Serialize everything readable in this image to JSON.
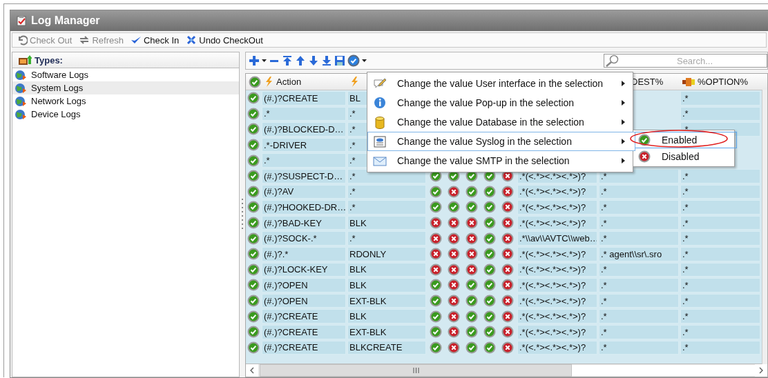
{
  "window": {
    "title": "Log Manager"
  },
  "toolbar": [
    {
      "label": "Check Out",
      "kind": "undo",
      "disabled": true
    },
    {
      "label": "Refresh",
      "kind": "refresh",
      "disabled": true
    },
    {
      "label": "Check In",
      "kind": "checkin",
      "disabled": false
    },
    {
      "label": "Undo CheckOut",
      "kind": "undocheckout",
      "disabled": false
    }
  ],
  "types_panel": {
    "title": "Types:",
    "items": [
      {
        "label": "Software Logs",
        "selected": false
      },
      {
        "label": "System Logs",
        "selected": true
      },
      {
        "label": "Network Logs",
        "selected": false
      },
      {
        "label": "Device Logs",
        "selected": false
      }
    ]
  },
  "grid_search": {
    "placeholder": "Search..."
  },
  "table": {
    "columns": [
      {
        "kind": "status"
      },
      {
        "kind": "action",
        "label": "Action"
      },
      {
        "kind": "bolt"
      },
      {
        "kind": "flag"
      },
      {
        "kind": "flag"
      },
      {
        "kind": "flag"
      },
      {
        "kind": "flag"
      },
      {
        "kind": "flag"
      },
      {
        "kind": "plain"
      },
      {
        "kind": "plain",
        "label": "DEST%"
      },
      {
        "kind": "plugin",
        "label": "%OPTION%"
      }
    ],
    "rows": [
      {
        "enabled": true,
        "action": "(#.)?CREATE",
        "column_2": "BL",
        "column_9": ".*"
      },
      {
        "enabled": true,
        "action": ".*",
        "column_2": ".*",
        "column_9": ".*"
      },
      {
        "enabled": true,
        "action": "(#.)?BLOCKED-D…",
        "column_2": ".*",
        "column_9": ".*"
      },
      {
        "enabled": true,
        "action": ".*-DRIVER",
        "column_2": ".*"
      },
      {
        "enabled": true,
        "action": ".*",
        "column_2": ".*"
      },
      {
        "enabled": true,
        "action": "(#.)?SUSPECT-D…",
        "column_2": ".*",
        "flags": [
          true,
          true,
          true,
          true,
          false
        ],
        "column_7": ".*(<.*><.*><.*>)?",
        "column_8": ".*",
        "column_9": ".*"
      },
      {
        "enabled": true,
        "action": "(#.)?AV",
        "column_2": ".*",
        "flags": [
          true,
          false,
          true,
          true,
          false
        ],
        "column_7": ".*(<.*><.*><.*>)?",
        "column_8": ".*",
        "column_9": ".*"
      },
      {
        "enabled": true,
        "action": "(#.)?HOOKED-DR…",
        "column_2": ".*",
        "flags": [
          true,
          true,
          true,
          true,
          false
        ],
        "column_7": ".*(<.*><.*><.*>)?",
        "column_8": ".*",
        "column_9": ".*"
      },
      {
        "enabled": true,
        "action": "(#.)?BAD-KEY",
        "column_2": "BLK",
        "flags": [
          false,
          false,
          false,
          true,
          false
        ],
        "column_7": ".*(<.*><.*><.*>)?",
        "column_8": ".*",
        "column_9": ".*"
      },
      {
        "enabled": true,
        "action": "(#.)?SOCK-.*",
        "column_2": ".*",
        "flags": [
          false,
          false,
          false,
          true,
          false
        ],
        "column_7": ".*\\\\av\\\\AVTC\\\\web…",
        "column_8": ".*",
        "column_9": ".*"
      },
      {
        "enabled": true,
        "action": "(#.)?.*",
        "column_2": "RDONLY",
        "flags": [
          false,
          false,
          false,
          true,
          false
        ],
        "column_7": ".*(<.*><.*><.*>)?",
        "column_8": ".* agent\\\\sr\\.sro",
        "column_9": ".*"
      },
      {
        "enabled": true,
        "action": "(#.)?LOCK-KEY",
        "column_2": "BLK",
        "flags": [
          false,
          false,
          false,
          true,
          false
        ],
        "column_7": ".*(<.*><.*><.*>)?",
        "column_8": ".*",
        "column_9": ".*"
      },
      {
        "enabled": true,
        "action": "(#.)?OPEN",
        "column_2": "BLK",
        "flags": [
          true,
          false,
          true,
          true,
          false
        ],
        "column_7": ".*(<.*><.*><.*>)?",
        "column_8": ".*",
        "column_9": ".*"
      },
      {
        "enabled": true,
        "action": "(#.)?OPEN",
        "column_2": "EXT-BLK",
        "flags": [
          true,
          false,
          true,
          true,
          false
        ],
        "column_7": ".*(<.*><.*><.*>)?",
        "column_8": ".*",
        "column_9": ".*"
      },
      {
        "enabled": true,
        "action": "(#.)?CREATE",
        "column_2": "BLK",
        "flags": [
          true,
          false,
          true,
          true,
          false
        ],
        "column_7": ".*(<.*><.*><.*>)?",
        "column_8": ".*",
        "column_9": ".*"
      },
      {
        "enabled": true,
        "action": "(#.)?CREATE",
        "column_2": "EXT-BLK",
        "flags": [
          true,
          false,
          true,
          true,
          false
        ],
        "column_7": ".*(<.*><.*><.*>)?",
        "column_8": ".*",
        "column_9": ".*"
      },
      {
        "enabled": true,
        "action": "(#.)?CREATE",
        "column_2": "BLKCREATE",
        "flags": [
          true,
          false,
          true,
          true,
          false
        ],
        "column_7": ".*(<.*><.*><.*>)?",
        "column_8": ".*",
        "column_9": ".*"
      }
    ]
  },
  "context_menu": {
    "items": [
      {
        "label": "Change the value User interface in the selection",
        "kind": "pencil",
        "selected": false
      },
      {
        "label": "Change the value Pop-up in the selection",
        "kind": "info",
        "selected": false
      },
      {
        "label": "Change the value Database in the selection",
        "kind": "database",
        "selected": false
      },
      {
        "label": "Change the value Syslog in the selection",
        "kind": "document",
        "selected": true,
        "submenu": [
          {
            "label": "Enabled",
            "kind": "enabled",
            "selected": true,
            "circled": true
          },
          {
            "label": "Disabled",
            "kind": "disabled",
            "selected": false,
            "circled": false
          }
        ]
      },
      {
        "label": "Change the value SMTP in the selection",
        "kind": "mail",
        "selected": false
      }
    ]
  }
}
